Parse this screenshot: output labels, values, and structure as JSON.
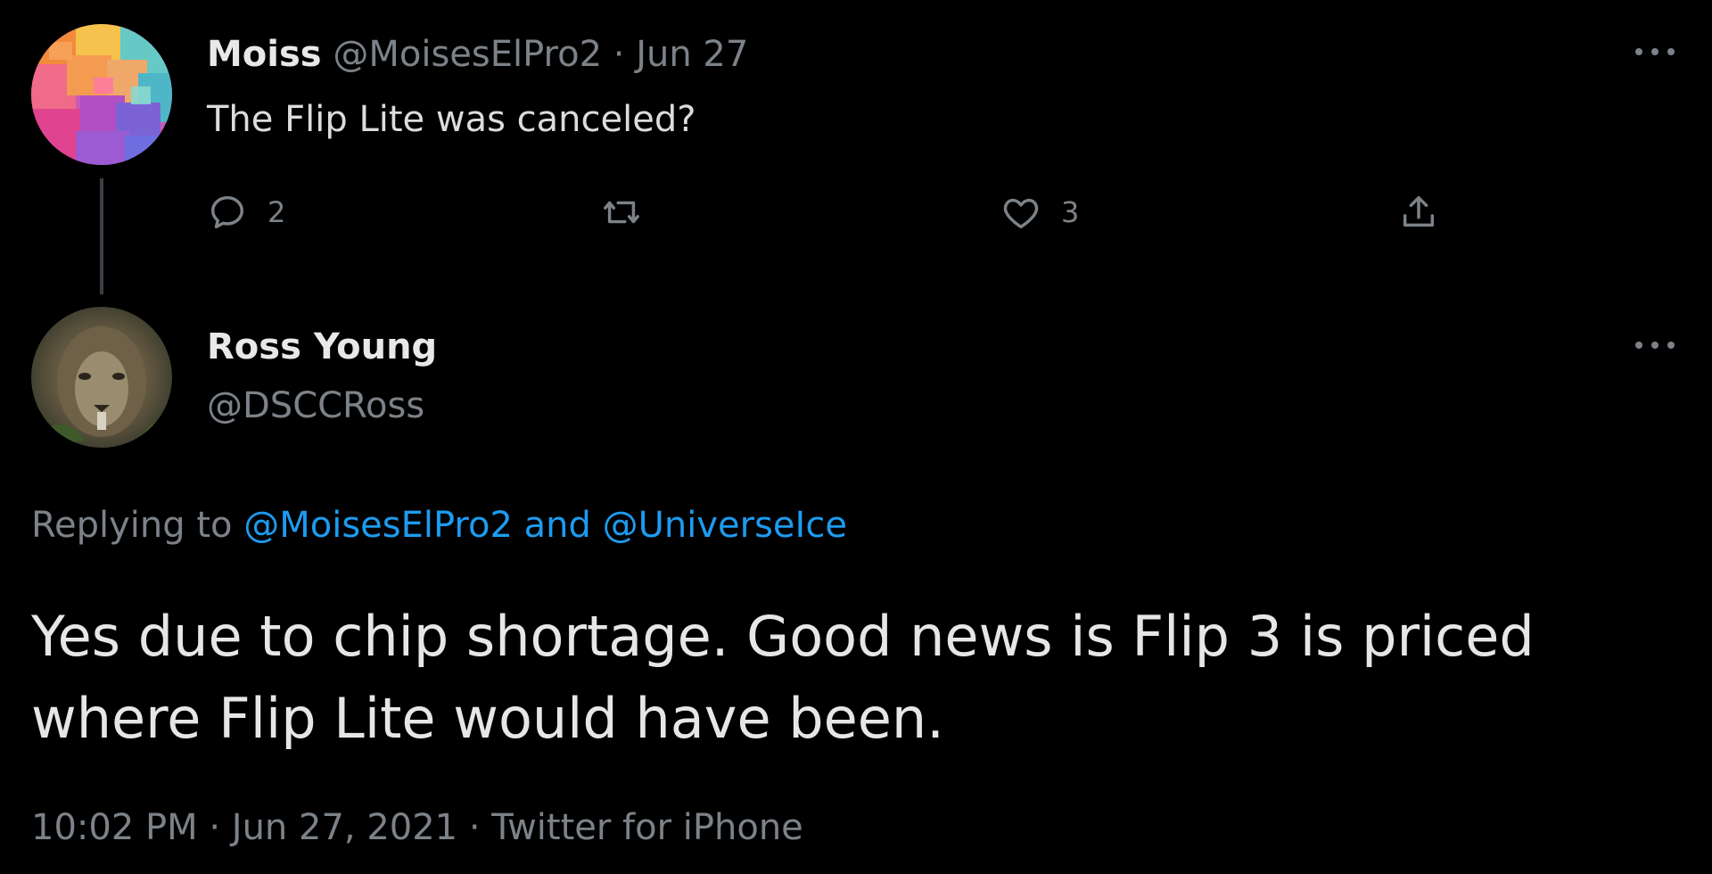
{
  "parent_tweet": {
    "display_name": "Moiss",
    "handle": "@MoisesElPro2",
    "separator": "·",
    "date": "Jun 27",
    "text": "The Flip Lite was canceled?",
    "reply_count": "2",
    "like_count": "3",
    "icons": {
      "avatar": "colorful-blocks-avatar",
      "more": "more-options-icon",
      "reply": "reply-icon",
      "retweet": "retweet-icon",
      "like": "heart-icon",
      "share": "share-icon"
    }
  },
  "main_tweet": {
    "display_name": "Ross Young",
    "handle": "@DSCCRoss",
    "replying_prefix": "Replying to",
    "replying_user_1": "@MoisesElPro2",
    "replying_and": "and",
    "replying_user_2": "@UniverseIce",
    "text_line_1": "Yes due to chip shortage. Good news is Flip 3 is priced",
    "text_line_2": "where Flip Lite would have been.",
    "time": "10:02 PM",
    "separator": "·",
    "date": "Jun 27, 2021",
    "source": "Twitter for iPhone",
    "icons": {
      "avatar": "lion-avatar",
      "more": "more-options-icon"
    }
  },
  "colors": {
    "background": "#000000",
    "text": "#e6e6e6",
    "muted": "#7c8288",
    "link": "#1d9bf0"
  }
}
